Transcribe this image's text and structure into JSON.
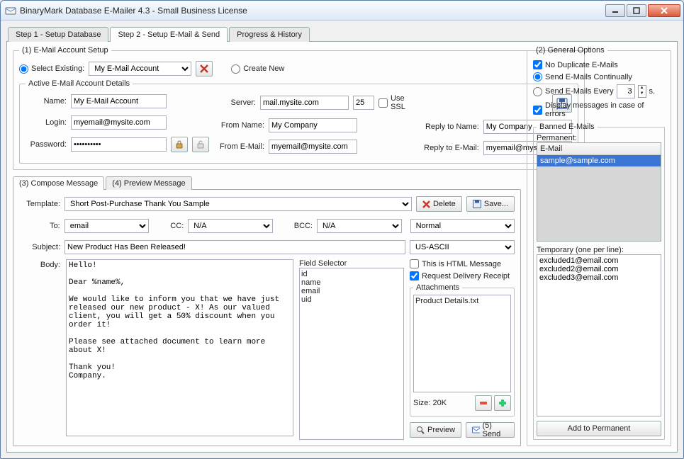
{
  "window": {
    "title": "BinaryMark Database E-Mailer 4.3 - Small Business License"
  },
  "tabs": {
    "t1": "Step 1 - Setup Database",
    "t2": "Step 2 - Setup E-Mail & Send",
    "t3": "Progress & History"
  },
  "account": {
    "group": "(1) E-Mail Account Setup",
    "selectExistingLabel": "Select Existing:",
    "selectExistingValue": "My E-Mail Account",
    "createNewLabel": "Create New",
    "detailsLegend": "Active E-Mail Account Details",
    "nameLabel": "Name:",
    "nameValue": "My E-Mail Account",
    "loginLabel": "Login:",
    "loginValue": "myemail@mysite.com",
    "passwordLabel": "Password:",
    "passwordValue": "**********",
    "serverLabel": "Server:",
    "serverValue": "mail.mysite.com",
    "portValue": "25",
    "useSSLLabel": "Use SSL",
    "fromNameLabel": "From Name:",
    "fromNameValue": "My Company",
    "fromEmailLabel": "From E-Mail:",
    "fromEmailValue": "myemail@mysite.com",
    "replyNameLabel": "Reply to Name:",
    "replyNameValue": "My Company",
    "replyEmailLabel": "Reply to E-Mail:",
    "replyEmailValue": "myemail@mysite.com"
  },
  "compose": {
    "tab3": "(3) Compose Message",
    "tab4": "(4) Preview Message",
    "templateLabel": "Template:",
    "templateValue": "Short Post-Purchase Thank You Sample",
    "deleteLabel": "Delete",
    "saveLabel": "Save...",
    "toLabel": "To:",
    "toValue": "email",
    "ccLabel": "CC:",
    "ccValue": "N/A",
    "bccLabel": "BCC:",
    "bccValue": "N/A",
    "priorityValue": "Normal",
    "subjectLabel": "Subject:",
    "subjectValue": "New Product Has Been Released!",
    "encodingValue": "US-ASCII",
    "bodyLabel": "Body:",
    "bodyText": "Hello!\n\nDear %name%,\n\nWe would like to inform you that we have just released our new product - X! As our valued client, you will get a 50% discount when you order it!\n\nPlease see attached document to learn more about X!\n\nThank you!\nCompany.",
    "fieldSelectorLabel": "Field Selector",
    "fields": {
      "f0": "id",
      "f1": "name",
      "f2": "email",
      "f3": "uid"
    },
    "htmlLabel": "This is HTML Message",
    "receiptLabel": "Request Delivery Receipt",
    "attachmentsLabel": "Attachments",
    "attachmentItem": "Product Details.txt",
    "sizeLabel": "Size: 20K",
    "previewLabel": "Preview",
    "sendLabel": "(5) Send"
  },
  "options": {
    "group": "(2) General Options",
    "noDup": "No Duplicate E-Mails",
    "continual": "Send E-Mails Continually",
    "everyPrefix": "Send E-Mails Every",
    "everyValue": "3",
    "everySuffix": "s.",
    "displayErrors": "Display messages in case of errors",
    "bannedLegend": "Banned E-Mails",
    "permanentLabel": "Permanent:",
    "bannedHeader": "E-Mail",
    "bannedRow": "sample@sample.com",
    "temporaryLabel": "Temporary (one per line):",
    "temporaryText": "excluded1@email.com\nexcluded2@email.com\nexcluded3@email.com",
    "addPermanent": "Add to Permanent"
  }
}
